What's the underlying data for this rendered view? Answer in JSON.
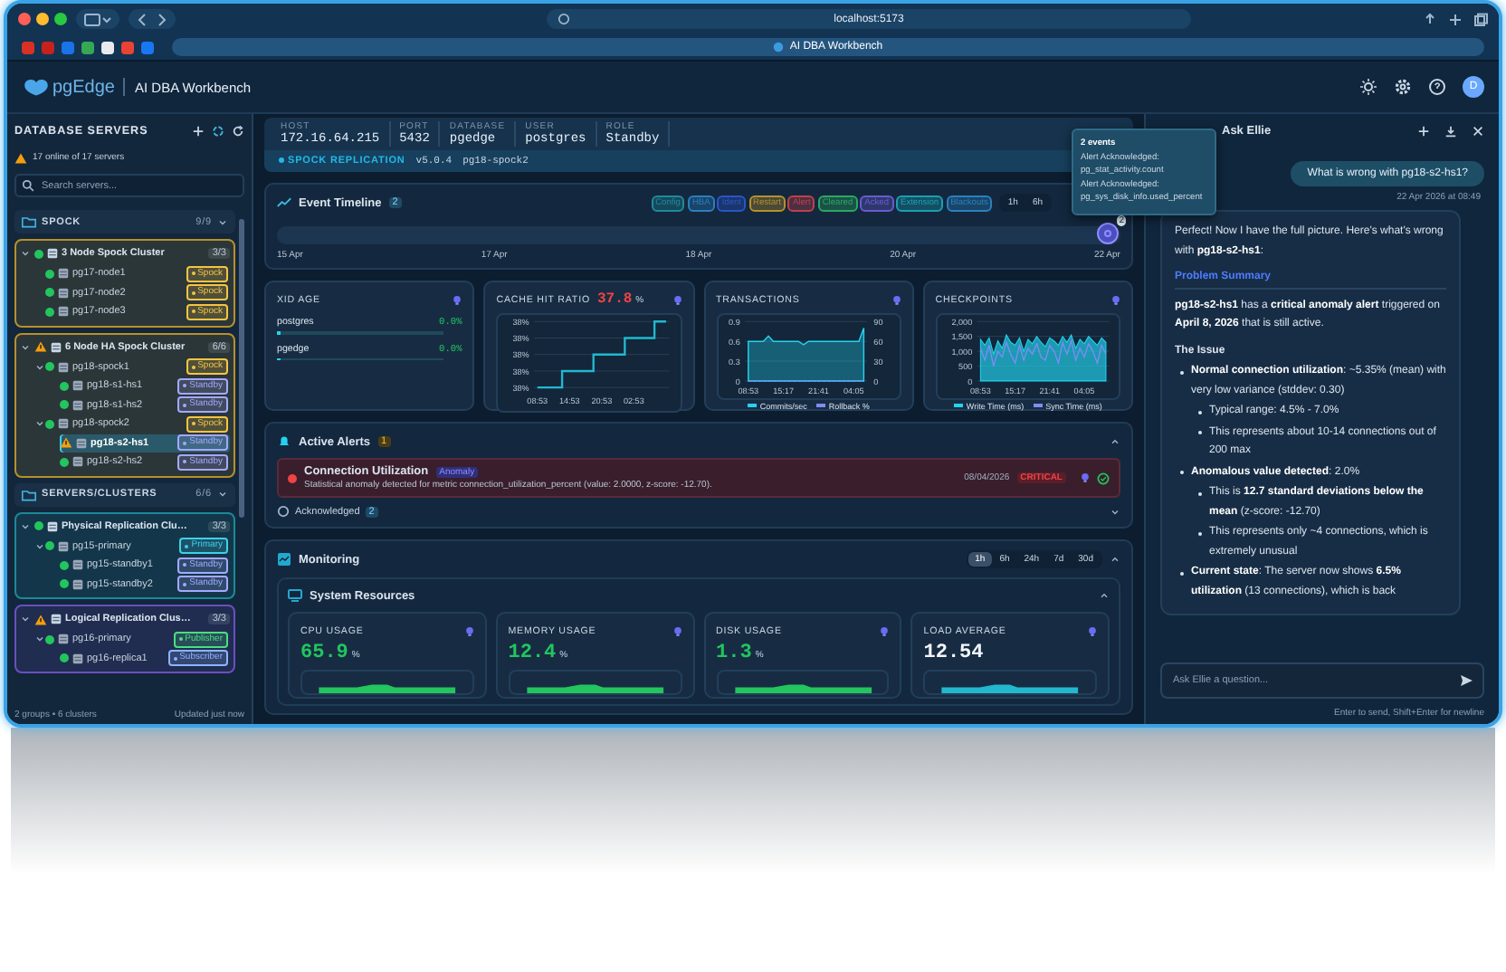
{
  "browser": {
    "url": "localhost:5173",
    "tab_title": "AI DBA Workbench"
  },
  "app": {
    "logo": "pgEdge",
    "title": "AI DBA Workbench",
    "avatar": "D"
  },
  "sidebar": {
    "title": "DATABASE SERVERS",
    "status": "17 online of 17 servers",
    "search_placeholder": "Search servers...",
    "groups": [
      {
        "name": "SPOCK",
        "count": "9/9",
        "expanded": true,
        "clusters": [
          {
            "name": "3 Node Spock Cluster",
            "count": "3/3",
            "warning": false,
            "expanded": true,
            "color": "#b8902a",
            "servers": [
              {
                "name": "pg17-node1",
                "warning": false,
                "selected": false,
                "tag": "Spock",
                "color": "#f5c542"
              },
              {
                "name": "pg17-node2",
                "warning": false,
                "selected": false,
                "tag": "Spock",
                "color": "#f5c542"
              },
              {
                "name": "pg17-node3",
                "warning": false,
                "selected": false,
                "tag": "Spock",
                "color": "#f5c542"
              }
            ]
          },
          {
            "name": "6 Node HA Spock Cluster",
            "count": "6/6",
            "warning": true,
            "expanded": true,
            "color": "#b8902a",
            "servers": [
              {
                "name": "pg18-spock1",
                "warning": false,
                "selected": false,
                "tag": "Spock",
                "color": "#f5c542",
                "expanded": true,
                "children": [
                  {
                    "name": "pg18-s1-hs1",
                    "warning": false,
                    "selected": false,
                    "tag": "Standby",
                    "color": "#a5a8ff"
                  },
                  {
                    "name": "pg18-s1-hs2",
                    "warning": false,
                    "selected": false,
                    "tag": "Standby",
                    "color": "#a5a8ff"
                  }
                ]
              },
              {
                "name": "pg18-spock2",
                "warning": false,
                "selected": false,
                "tag": "Spock",
                "color": "#f5c542",
                "expanded": true,
                "children": [
                  {
                    "name": "pg18-s2-hs1",
                    "warning": true,
                    "selected": true,
                    "tag": "Standby",
                    "color": "#a5a8ff"
                  },
                  {
                    "name": "pg18-s2-hs2",
                    "warning": false,
                    "selected": false,
                    "tag": "Standby",
                    "color": "#a5a8ff"
                  }
                ]
              }
            ]
          }
        ]
      },
      {
        "name": "SERVERS/CLUSTERS",
        "count": "6/6",
        "expanded": true,
        "clusters": [
          {
            "name": "Physical Replication Clu…",
            "count": "3/3",
            "warning": false,
            "expanded": true,
            "color": "#1a8a9a",
            "servers": [
              {
                "name": "pg15-primary",
                "warning": false,
                "selected": false,
                "tag": "Primary",
                "color": "#3fd0e8",
                "expanded": true,
                "children": [
                  {
                    "name": "pg15-standby1",
                    "warning": false,
                    "selected": false,
                    "tag": "Standby",
                    "color": "#a5a8ff"
                  },
                  {
                    "name": "pg15-standby2",
                    "warning": false,
                    "selected": false,
                    "tag": "Standby",
                    "color": "#a5a8ff"
                  }
                ]
              }
            ]
          },
          {
            "name": "Logical Replication Clus…",
            "count": "3/3",
            "warning": true,
            "expanded": true,
            "color": "#6a4fc0",
            "servers": [
              {
                "name": "pg16-primary",
                "warning": false,
                "selected": false,
                "tag": "Publisher",
                "color": "#4ade80",
                "expanded": true,
                "children": [
                  {
                    "name": "pg16-replica1",
                    "warning": false,
                    "selected": false,
                    "tag": "Subscriber",
                    "color": "#8ab4ff"
                  }
                ]
              }
            ]
          }
        ]
      }
    ],
    "footer_left": "2 groups • 6 clusters",
    "footer_right": "Updated just now"
  },
  "server_info": {
    "fields": [
      {
        "label": "HOST",
        "value": "172.16.64.215"
      },
      {
        "label": "PORT",
        "value": "5432"
      },
      {
        "label": "DATABASE",
        "value": "pgedge"
      },
      {
        "label": "USER",
        "value": "postgres"
      },
      {
        "label": "ROLE",
        "value": "Standby"
      }
    ],
    "replication": {
      "label": "SPOCK REPLICATION",
      "version": "v5.0.4",
      "node": "pg18-spock2"
    }
  },
  "timeline": {
    "title": "Event Timeline",
    "count": "2",
    "filters": [
      {
        "label": "Config",
        "color": "#1f8a9a"
      },
      {
        "label": "HBA",
        "color": "#2a7fc0"
      },
      {
        "label": "Ident",
        "color": "#2a55c8"
      },
      {
        "label": "Restart",
        "color": "#b8902a"
      },
      {
        "label": "Alert",
        "color": "#c0404a"
      },
      {
        "label": "Cleared",
        "color": "#2aa860"
      },
      {
        "label": "Acked",
        "color": "#6a5ad0"
      },
      {
        "label": "Extension",
        "color": "#1aa0b0"
      },
      {
        "label": "Blackouts",
        "color": "#2a80c0"
      }
    ],
    "ranges": [
      {
        "label": "1h",
        "selected": false
      },
      {
        "label": "6h",
        "selected": false
      }
    ],
    "axis": [
      "15 Apr",
      "17 Apr",
      "18 Apr",
      "20 Apr",
      "22 Apr"
    ],
    "marker_count": "2",
    "tooltip": {
      "title": "2 events",
      "lines": [
        "Alert Acknowledged:",
        "pg_stat_activity.count",
        "Alert Acknowledged:",
        "pg_sys_disk_info.used_percent"
      ]
    }
  },
  "metrics": [
    {
      "kind": "bars",
      "title": "XID AGE",
      "rows": [
        {
          "name": "postgres",
          "value": "0.0%",
          "level": 0
        },
        {
          "name": "pgedge",
          "value": "0.0%",
          "level": 0
        }
      ]
    },
    {
      "kind": "picture_chart",
      "title": "CACHE HIT RATIO",
      "value": "37.8",
      "unit": "%",
      "y_labels": [
        "38%",
        "38%",
        "38%",
        "38%",
        "38%"
      ],
      "x_labels": [
        "08:53",
        "14:53",
        "20:53",
        "02:53"
      ]
    },
    {
      "kind": "chart",
      "title": "TRANSACTIONS",
      "chart_data": {
        "type": "area",
        "grid": true,
        "categories": [
          "08:53",
          null,
          null,
          null,
          null,
          null,
          null,
          "15:17",
          null,
          null,
          null,
          null,
          null,
          null,
          "21:41",
          null,
          null,
          null,
          null,
          null,
          null,
          "04:05",
          null,
          null
        ],
        "series": [
          {
            "name": "Commits/sec",
            "type": "area",
            "color": "#22d3ee",
            "values": [
              0.6,
              0.6,
              0.6,
              0.6,
              0.68,
              0.6,
              0.6,
              0.6,
              0.6,
              0.6,
              0.6,
              0.55,
              0.6,
              0.6,
              0.6,
              0.6,
              0.6,
              0.6,
              0.6,
              0.6,
              0.6,
              0.6,
              0.6,
              0.8
            ]
          },
          {
            "name": "Rollback %",
            "type": "line",
            "line_style": "dashed",
            "color": "#818cf8",
            "values": [
              0,
              0,
              0,
              0,
              0,
              0,
              0,
              0,
              0,
              0,
              0,
              0,
              0,
              0,
              0,
              0,
              0,
              0,
              0,
              0,
              0,
              0,
              0,
              0
            ]
          }
        ],
        "yticks": [
          0,
          0.3,
          0.6,
          0.9
        ],
        "ylim": [
          0,
          0.9
        ],
        "y2ticks": [
          0,
          30,
          60,
          90
        ],
        "y2lim": [
          0,
          90
        ]
      }
    },
    {
      "kind": "chart",
      "title": "CHECKPOINTS",
      "chart_data": {
        "type": "area",
        "grid": true,
        "categories": [
          "08:53",
          null,
          null,
          null,
          null,
          null,
          null,
          null,
          "15:17",
          null,
          null,
          null,
          null,
          null,
          null,
          null,
          "21:41",
          null,
          null,
          null,
          null,
          null,
          null,
          null,
          "04:05",
          null,
          null,
          null,
          null,
          null
        ],
        "series": [
          {
            "name": "Write Time (ms)",
            "type": "area",
            "color": "#22d3ee",
            "values": [
              1400,
              1200,
              1450,
              900,
              1350,
              1100,
              1550,
              1300,
              1200,
              1450,
              1000,
              1400,
              1250,
              1500,
              1300,
              1150,
              1450,
              1350,
              1200,
              1500,
              1300,
              1550,
              1100,
              1400,
              1250,
              1500,
              1350,
              1200,
              1450,
              1300
            ]
          },
          {
            "name": "Sync Time (ms)",
            "type": "line",
            "line_style": "solid",
            "color": "#818cf8",
            "values": [
              1100,
              700,
              1200,
              500,
              1000,
              800,
              1300,
              900,
              600,
              1200,
              700,
              1100,
              900,
              1250,
              800,
              700,
              1200,
              1000,
              600,
              1300,
              900,
              1350,
              700,
              1100,
              800,
              1250,
              1000,
              600,
              1200,
              900
            ]
          }
        ],
        "yticks": [
          {
            "value": 0,
            "label": "0"
          },
          {
            "value": 500,
            "label": "500"
          },
          {
            "value": 1000,
            "label": "1,000"
          },
          {
            "value": 1500,
            "label": "1,500"
          },
          {
            "value": 2000,
            "label": "2,000"
          }
        ],
        "ylim": [
          0,
          2000
        ]
      }
    }
  ],
  "alerts": {
    "title": "Active Alerts",
    "count": "1",
    "expanded": true,
    "items": [
      {
        "title": "Connection Utilization",
        "tag": "Anomaly",
        "description": "Statistical anomaly detected for metric connection_utilization_percent (value: 2.0000, z-score: -12.70).",
        "date": "08/04/2026",
        "severity": "CRITICAL"
      }
    ],
    "acknowledged": {
      "label": "Acknowledged",
      "count": "2",
      "expanded": false
    }
  },
  "monitoring": {
    "title": "Monitoring",
    "expanded": true,
    "ranges": [
      {
        "label": "1h",
        "selected": true
      },
      {
        "label": "6h",
        "selected": false
      },
      {
        "label": "24h",
        "selected": false
      },
      {
        "label": "7d",
        "selected": false
      },
      {
        "label": "30d",
        "selected": false
      }
    ],
    "section": "System Resources",
    "section_expanded": true,
    "cards": [
      {
        "title": "CPU USAGE",
        "value": "65.9",
        "unit": "%",
        "color": "#22c55e"
      },
      {
        "title": "MEMORY USAGE",
        "value": "12.4",
        "unit": "%",
        "color": "#22c55e"
      },
      {
        "title": "DISK USAGE",
        "value": "1.3",
        "unit": "%",
        "color": "#22c55e"
      },
      {
        "title": "LOAD AVERAGE",
        "value": "12.54",
        "color": "#f1f5f9"
      }
    ]
  },
  "chat": {
    "title": "Ask Ellie",
    "user_message": "What is wrong with pg18-s2-hs1?",
    "timestamp": "22 Apr 2026 at 08:49",
    "reply": [
      {
        "kind": "p",
        "text": "Perfect! Now I have the full picture. Here's what's wrong with **pg18-s2-hs1**:"
      },
      {
        "kind": "heading",
        "text": "Problem Summary"
      },
      {
        "kind": "p",
        "text": "**pg18-s2-hs1** has a **critical anomaly alert** triggered on **April 8, 2026** that is still active."
      },
      {
        "kind": "subheading",
        "text": "The Issue"
      },
      {
        "kind": "list",
        "items": [
          {
            "text": "**Normal connection utilization**: ~5.35% (mean) with very low variance (stddev: 0.30)",
            "children": [
              {
                "text": "Typical range: 4.5% - 7.0%"
              },
              {
                "text": "This represents about 10-14 connections out of 200 max"
              }
            ]
          },
          {
            "text": "**Anomalous value detected**: 2.0%",
            "children": [
              {
                "text": "This is **12.7 standard deviations below the mean** (z-score: -12.70)"
              },
              {
                "text": "This represents only ~4 connections, which is extremely unusual"
              }
            ]
          },
          {
            "text": "**Current state**: The server now shows **6.5% utilization** (13 connections), which is back"
          }
        ]
      }
    ],
    "input_placeholder": "Ask Ellie a question...",
    "hint": "Enter to send, Shift+Enter for newline"
  }
}
